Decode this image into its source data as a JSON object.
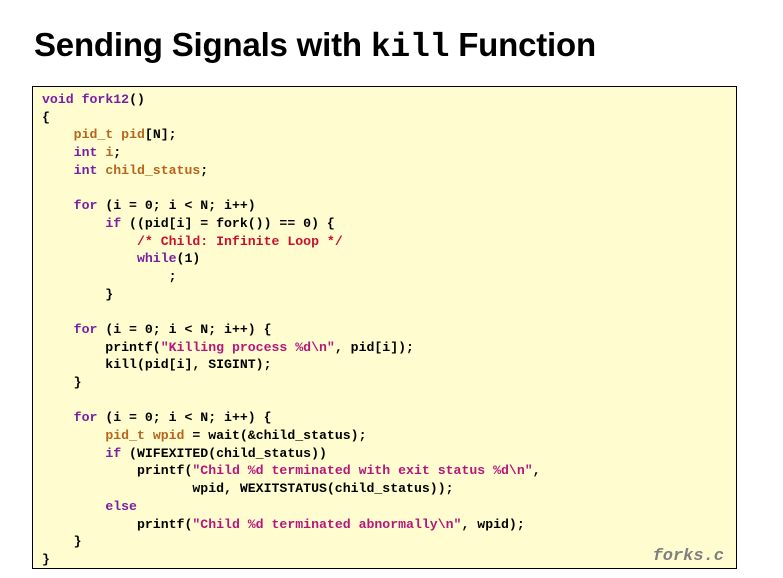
{
  "slide": {
    "title_before": "Sending Signals with ",
    "title_code": "kill",
    "title_after": " Function"
  },
  "code": {
    "lines": [
      [
        {
          "t": "void",
          "c": "kw"
        },
        {
          "t": " "
        },
        {
          "t": "fork12",
          "c": "kw"
        },
        {
          "t": "()"
        }
      ],
      [
        {
          "t": "{"
        }
      ],
      [
        {
          "t": "    "
        },
        {
          "t": "pid_t",
          "c": "ty"
        },
        {
          "t": " "
        },
        {
          "t": "pid",
          "c": "ty"
        },
        {
          "t": "[N];"
        }
      ],
      [
        {
          "t": "    "
        },
        {
          "t": "int",
          "c": "kw"
        },
        {
          "t": " "
        },
        {
          "t": "i",
          "c": "ty"
        },
        {
          "t": ";"
        }
      ],
      [
        {
          "t": "    "
        },
        {
          "t": "int",
          "c": "kw"
        },
        {
          "t": " "
        },
        {
          "t": "child_status",
          "c": "ty"
        },
        {
          "t": ";"
        }
      ],
      [
        {
          "t": ""
        }
      ],
      [
        {
          "t": "    "
        },
        {
          "t": "for",
          "c": "kw"
        },
        {
          "t": " (i = 0; i < N; i++)"
        }
      ],
      [
        {
          "t": "        "
        },
        {
          "t": "if",
          "c": "kw"
        },
        {
          "t": " ((pid[i] = fork()) == 0) {"
        }
      ],
      [
        {
          "t": "            "
        },
        {
          "t": "/* Child: Infinite Loop */",
          "c": "cm"
        }
      ],
      [
        {
          "t": "            "
        },
        {
          "t": "while",
          "c": "kw"
        },
        {
          "t": "(1)"
        }
      ],
      [
        {
          "t": "                ;"
        }
      ],
      [
        {
          "t": "        }"
        }
      ],
      [
        {
          "t": ""
        }
      ],
      [
        {
          "t": "    "
        },
        {
          "t": "for",
          "c": "kw"
        },
        {
          "t": " (i = 0; i < N; i++) {"
        }
      ],
      [
        {
          "t": "        printf("
        },
        {
          "t": "\"Killing process %d\\n\"",
          "c": "str"
        },
        {
          "t": ", pid[i]);"
        }
      ],
      [
        {
          "t": "        kill(pid[i], SIGINT);"
        }
      ],
      [
        {
          "t": "    }"
        }
      ],
      [
        {
          "t": ""
        }
      ],
      [
        {
          "t": "    "
        },
        {
          "t": "for",
          "c": "kw"
        },
        {
          "t": " (i = 0; i < N; i++) {"
        }
      ],
      [
        {
          "t": "        "
        },
        {
          "t": "pid_t",
          "c": "ty"
        },
        {
          "t": " "
        },
        {
          "t": "wpid",
          "c": "ty"
        },
        {
          "t": " = wait(&child_status);"
        }
      ],
      [
        {
          "t": "        "
        },
        {
          "t": "if",
          "c": "kw"
        },
        {
          "t": " (WIFEXITED(child_status))"
        }
      ],
      [
        {
          "t": "            printf("
        },
        {
          "t": "\"Child %d terminated with exit status %d\\n\"",
          "c": "str"
        },
        {
          "t": ","
        }
      ],
      [
        {
          "t": "                   wpid, WEXITSTATUS(child_status));"
        }
      ],
      [
        {
          "t": "        "
        },
        {
          "t": "else",
          "c": "kw"
        }
      ],
      [
        {
          "t": "            printf("
        },
        {
          "t": "\"Child %d terminated abnormally\\n\"",
          "c": "str"
        },
        {
          "t": ", wpid);"
        }
      ],
      [
        {
          "t": "    }"
        }
      ],
      [
        {
          "t": "}"
        }
      ]
    ],
    "filename": "forks.c"
  }
}
